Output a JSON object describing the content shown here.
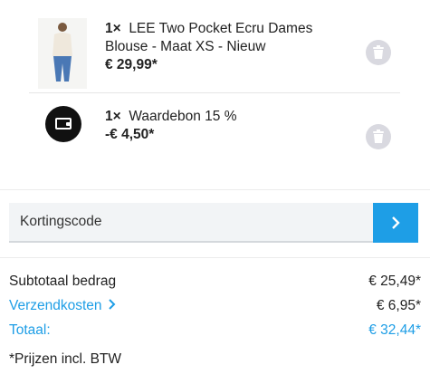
{
  "colors": {
    "accent": "#1e9ee6",
    "text": "#222222"
  },
  "cart": {
    "items": [
      {
        "qty": "1×",
        "name": "LEE Two Pocket Ecru Dames Blouse - Maat XS - Nieuw",
        "price": "€ 29,99*",
        "image": "blouse-product-photo"
      },
      {
        "qty": "1×",
        "name": "Waardebon 15 %",
        "price": "-€ 4,50*",
        "image": "voucher-wallet-icon"
      }
    ]
  },
  "coupon": {
    "placeholder": "Kortingscode",
    "button_icon": "chevron-right-icon"
  },
  "summary": {
    "subtotal_label": "Subtotaal bedrag",
    "subtotal_value": "€ 25,49*",
    "shipping_label": "Verzendkosten",
    "shipping_value": "€ 6,95*",
    "total_label": "Totaal:",
    "total_value": "€ 32,44*"
  },
  "note": "*Prijzen incl. BTW"
}
